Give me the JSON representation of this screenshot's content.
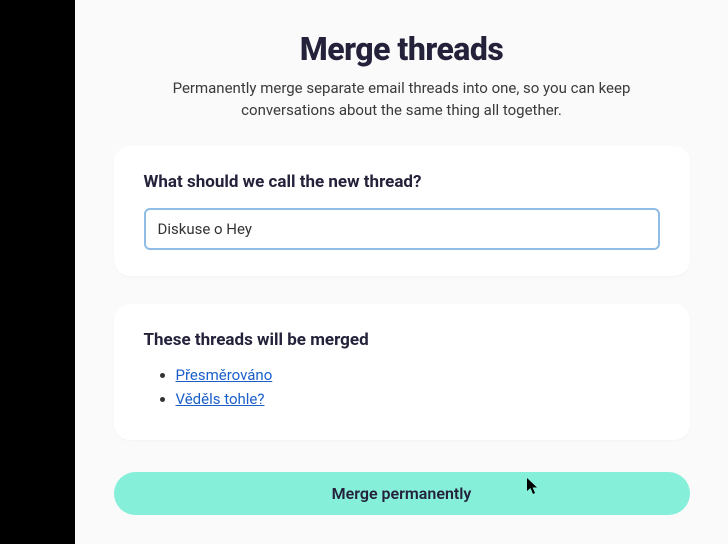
{
  "header": {
    "title": "Merge threads",
    "subtitle": "Permanently merge separate email threads into one, so you can keep conversations about the same thing all together."
  },
  "name_card": {
    "heading": "What should we call the new thread?",
    "input_value": "Diskuse o Hey"
  },
  "merge_card": {
    "heading": "These threads will be merged",
    "threads": [
      "Přesměrováno",
      "Věděls tohle?"
    ]
  },
  "cta": {
    "label": "Merge permanently"
  }
}
